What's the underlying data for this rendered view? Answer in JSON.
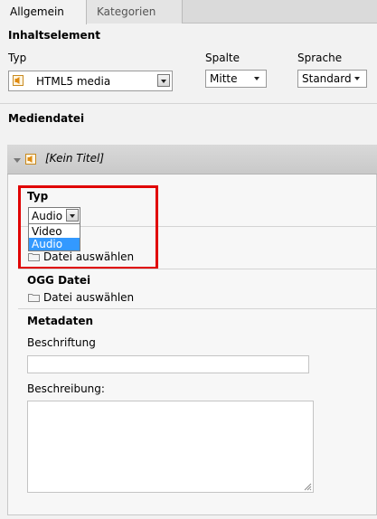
{
  "tabs": [
    {
      "label": "Allgemein",
      "active": true
    },
    {
      "label": "Kategorien",
      "active": false
    }
  ],
  "content_section": {
    "title": "Inhaltselement",
    "typ_label": "Typ",
    "typ_value": "HTML5 media",
    "spalte_label": "Spalte",
    "spalte_value": "Mitte",
    "sprache_label": "Sprache",
    "sprache_value": "Standard"
  },
  "media_section": {
    "title": "Mediendatei",
    "item_title": "[Kein Titel]",
    "typ_label": "Typ",
    "typ_value": "Audio",
    "typ_options": [
      "Video",
      "Audio"
    ],
    "typ_selected_option": "Audio",
    "file_select_label": "Datei auswählen",
    "ogg_label": "OGG Datei",
    "ogg_file_select_label": "Datei auswählen",
    "metadata_title": "Metadaten",
    "caption_label": "Beschriftung",
    "caption_value": "",
    "description_label": "Beschreibung:",
    "description_value": ""
  },
  "colors": {
    "highlight_box": "#e00000",
    "selected_option": "#3399ff",
    "speaker_icon": "#f0a020"
  },
  "icons": {
    "speaker": "speaker-icon",
    "folder": "folder-icon",
    "collapse": "collapse-arrow-icon"
  }
}
